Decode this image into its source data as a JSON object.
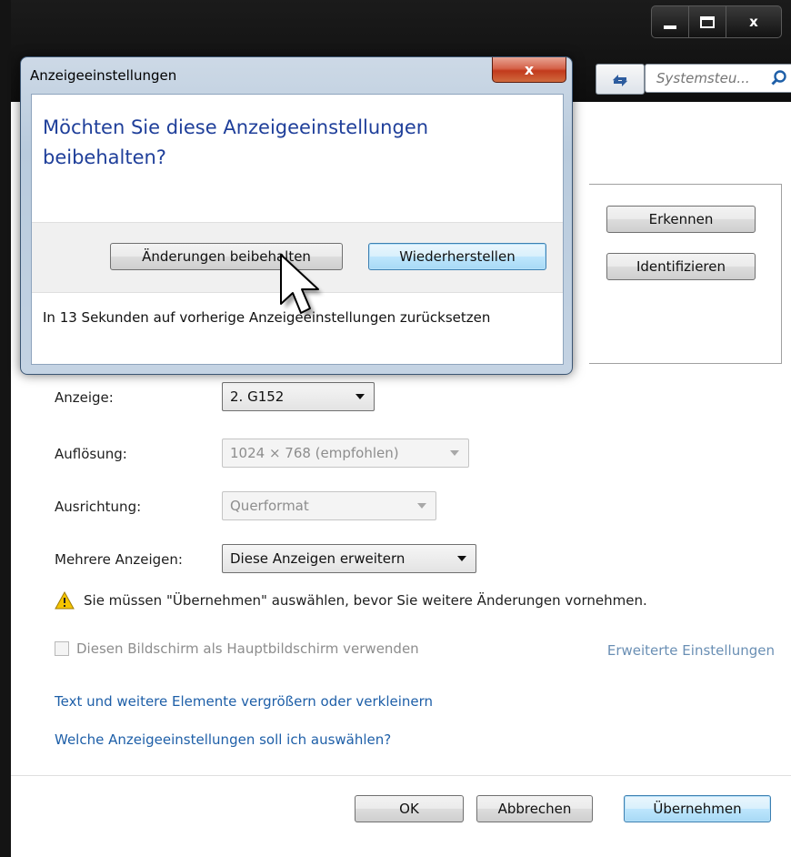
{
  "window": {
    "caption": {
      "minimize": "–",
      "maximize": "□",
      "close": "x"
    },
    "search_placeholder": "Systemsteu...",
    "detect_button": "Erkennen",
    "identify_button": "Identifizieren",
    "settings": {
      "display_label": "Anzeige:",
      "display_value": "2. G152",
      "resolution_label": "Auflösung:",
      "resolution_value": "1024 × 768 (empfohlen)",
      "orientation_label": "Ausrichtung:",
      "orientation_value": "Querformat",
      "multi_label": "Mehrere Anzeigen:",
      "multi_value": "Diese Anzeigen erweitern"
    },
    "warning": "Sie müssen \"Übernehmen\" auswählen, bevor Sie weitere Änderungen vornehmen.",
    "primary_checkbox": "Diesen Bildschirm als Hauptbildschirm verwenden",
    "advanced_link": "Erweiterte Einstellungen",
    "link_text_size": "Text und weitere Elemente vergrößern oder verkleinern",
    "link_which_settings": "Welche Anzeigeeinstellungen soll ich auswählen?",
    "ok_button": "OK",
    "cancel_button": "Abbrechen",
    "apply_button": "Übernehmen"
  },
  "dialog": {
    "title": "Anzeigeeinstellungen",
    "close": "x",
    "question": "Möchten Sie diese Anzeigeeinstellungen beibehalten?",
    "keep_button": "Änderungen beibehalten",
    "revert_button": "Wiederherstellen",
    "countdown_note": "In 13 Sekunden auf vorherige Anzeigeeinstellungen zurücksetzen"
  },
  "icons": [
    "refresh-icon",
    "search-icon",
    "warning-icon",
    "mouse-cursor-icon"
  ],
  "colors": {
    "question_blue": "#1f3f9a",
    "link_blue": "#1e5fa8",
    "warning_yellow": "#f5c400"
  }
}
